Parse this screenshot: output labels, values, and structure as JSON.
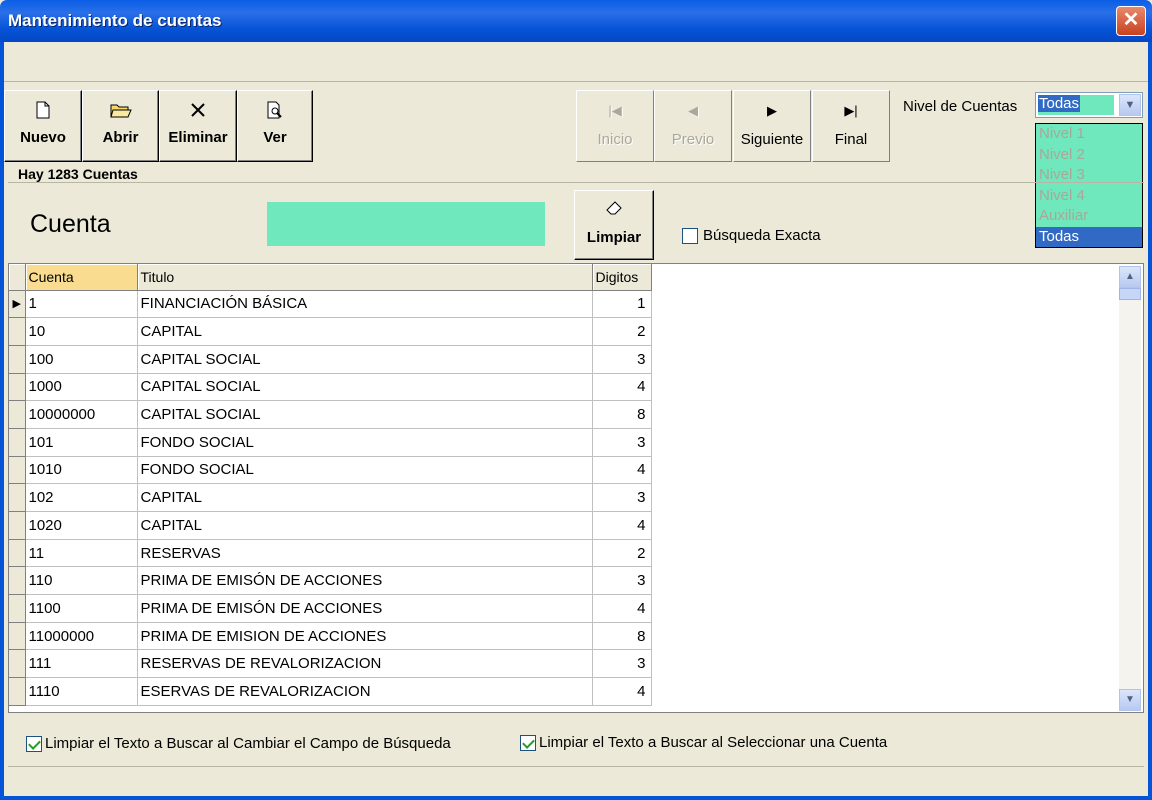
{
  "window": {
    "title": "Mantenimiento de cuentas",
    "close": "✕"
  },
  "toolbar": {
    "nuevo": "Nuevo",
    "abrir": "Abrir",
    "eliminar": "Eliminar",
    "ver": "Ver"
  },
  "nav": {
    "inicio": "Inicio",
    "previo": "Previo",
    "siguiente": "Siguiente",
    "final": "Final"
  },
  "nivel": {
    "label": "Nivel de Cuentas",
    "selected": "Todas",
    "options": [
      "Nivel 1",
      "Nivel 2",
      "Nivel 3",
      "Nivel 4",
      "Auxiliar",
      "Todas"
    ]
  },
  "summary": {
    "count_text": "Hay 1283  Cuentas"
  },
  "search": {
    "label": "Cuenta",
    "value": "",
    "limpiar": "Limpiar",
    "exacta_label": "Búsqueda Exacta",
    "exacta_checked": false
  },
  "grid": {
    "headers": [
      "Cuenta",
      "Titulo",
      "Digitos"
    ],
    "rows": [
      [
        "1",
        "FINANCIACIÓN BÁSICA",
        "1"
      ],
      [
        "10",
        "CAPITAL",
        "2"
      ],
      [
        "100",
        "CAPITAL SOCIAL",
        "3"
      ],
      [
        "1000",
        "CAPITAL SOCIAL",
        "4"
      ],
      [
        "10000000",
        "CAPITAL SOCIAL",
        "8"
      ],
      [
        "101",
        "FONDO SOCIAL",
        "3"
      ],
      [
        "1010",
        "FONDO SOCIAL",
        "4"
      ],
      [
        "102",
        "CAPITAL",
        "3"
      ],
      [
        "1020",
        "CAPITAL",
        "4"
      ],
      [
        "11",
        "RESERVAS",
        "2"
      ],
      [
        "110",
        "PRIMA DE EMISÓN DE ACCIONES",
        "3"
      ],
      [
        "1100",
        "PRIMA DE EMISÓN DE ACCIONES",
        "4"
      ],
      [
        "11000000",
        "PRIMA DE EMISION DE ACCIONES",
        "8"
      ],
      [
        "111",
        "RESERVAS DE REVALORIZACION",
        "3"
      ],
      [
        "1110",
        "ESERVAS DE REVALORIZACION",
        "4"
      ]
    ]
  },
  "options": {
    "limpiar_cambiar": "Limpiar el Texto a Buscar al Cambiar el Campo de Búsqueda",
    "limpiar_seleccionar": "Limpiar el Texto a Buscar al Seleccionar una Cuenta"
  },
  "colors": {
    "field_bg": "#6fe8bd",
    "selection": "#316ac5",
    "window_bg": "#ece9d8"
  }
}
